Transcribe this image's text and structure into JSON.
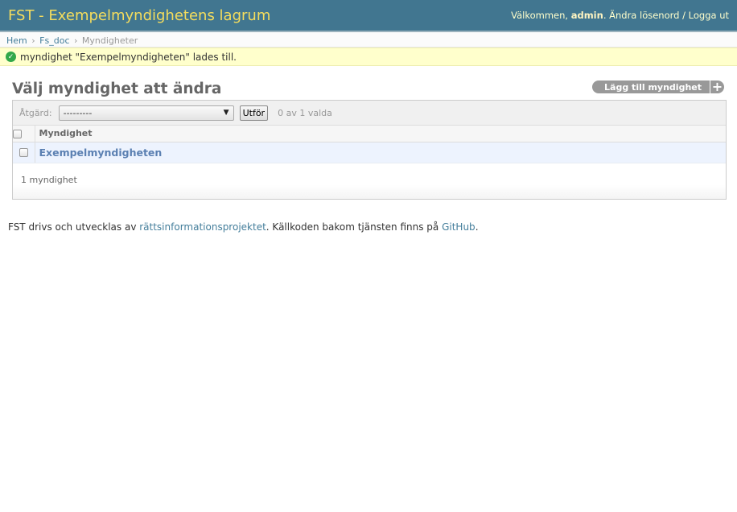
{
  "header": {
    "site_title": "FST - Exempelmyndighetens lagrum",
    "welcome": "Välkommen,",
    "username": "admin",
    "change_password": "Ändra lösenord",
    "separator": "/",
    "logout": "Logga ut"
  },
  "breadcrumbs": {
    "home": "Hem",
    "app": "Fs_doc",
    "current": "Myndigheter",
    "sep": "›"
  },
  "message": {
    "icon": "check-circle-icon",
    "text": "myndighet \"Exempelmyndigheten\" lades till."
  },
  "content": {
    "title": "Välj myndighet att ändra",
    "add_button": "Lägg till myndighet",
    "add_icon": "+"
  },
  "actions": {
    "label": "Åtgärd:",
    "selected_value": "---------",
    "go_button": "Utför",
    "counter": "0 av 1 valda"
  },
  "table": {
    "column_header": "Myndighet",
    "rows": [
      {
        "name": "Exempelmyndigheten"
      }
    ]
  },
  "paginator": {
    "text": "1 myndighet"
  },
  "footer": {
    "text_before": "FST drivs och utvecklas av ",
    "link1": "rättsinformationsprojektet",
    "text_middle": ". Källkoden bakom tjänsten finns på ",
    "link2": "GitHub",
    "text_after": "."
  },
  "colors": {
    "header_bg": "#417690",
    "branding": "#f5dd5d",
    "message_bg": "#ffffcc",
    "success": "#32a84a",
    "link": "#447e9b"
  }
}
